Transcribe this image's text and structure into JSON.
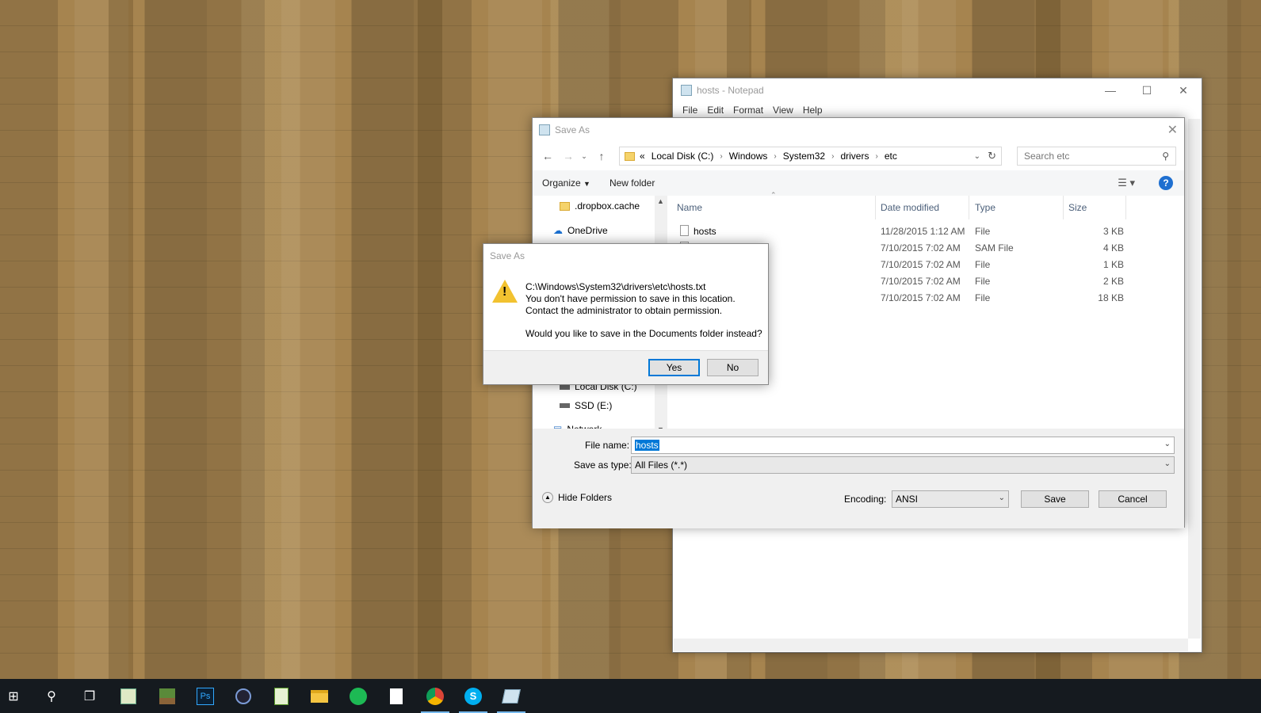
{
  "notepad": {
    "title": "hosts - Notepad",
    "menu": [
      "File",
      "Edit",
      "Format",
      "View",
      "Help"
    ]
  },
  "saveas": {
    "title": "Save As",
    "address": [
      "«",
      "Local Disk (C:)",
      "Windows",
      "System32",
      "drivers",
      "etc"
    ],
    "search_placeholder": "Search etc",
    "toolbar": {
      "organize": "Organize",
      "new_folder": "New folder"
    },
    "tree": [
      ".dropbox.cache",
      "OneDrive",
      "Local Disk (C:)",
      "SSD (E:)",
      "Network"
    ],
    "columns": [
      "Name",
      "Date modified",
      "Type",
      "Size"
    ],
    "files": [
      {
        "name": "hosts",
        "date": "11/28/2015 1:12 AM",
        "type": "File",
        "size": "3 KB"
      },
      {
        "name": "",
        "date": "7/10/2015 7:02 AM",
        "type": "SAM File",
        "size": "4 KB"
      },
      {
        "name": "",
        "date": "7/10/2015 7:02 AM",
        "type": "File",
        "size": "1 KB"
      },
      {
        "name": "",
        "date": "7/10/2015 7:02 AM",
        "type": "File",
        "size": "2 KB"
      },
      {
        "name": "",
        "date": "7/10/2015 7:02 AM",
        "type": "File",
        "size": "18 KB"
      }
    ],
    "file_name_label": "File name:",
    "file_name_value": "hosts",
    "save_type_label": "Save as type:",
    "save_type_value": "All Files  (*.*)",
    "hide_folders": "Hide Folders",
    "encoding_label": "Encoding:",
    "encoding_value": "ANSI",
    "save_btn": "Save",
    "cancel_btn": "Cancel"
  },
  "msgbox": {
    "title": "Save As",
    "path": "C:\\Windows\\System32\\drivers\\etc\\hosts.txt",
    "line1": "You don't have permission to save in this location.",
    "line2": "Contact the administrator to obtain permission.",
    "question": "Would you like to save in the Documents folder instead?",
    "yes": "Yes",
    "no": "No"
  },
  "taskbar": {
    "icons": [
      "start-icon",
      "search-icon",
      "task-view-icon",
      "notepad-plus-icon",
      "minecraft-icon",
      "photoshop-icon",
      "cinema4d-icon",
      "spreadsheet-icon",
      "file-explorer-icon",
      "spotify-icon",
      "blank-file-icon",
      "chrome-icon",
      "skype-icon",
      "notepad-icon"
    ],
    "photoshop_label": "Ps",
    "colors": {
      "accent": "#76b9ed",
      "background": "#151a1f"
    }
  }
}
